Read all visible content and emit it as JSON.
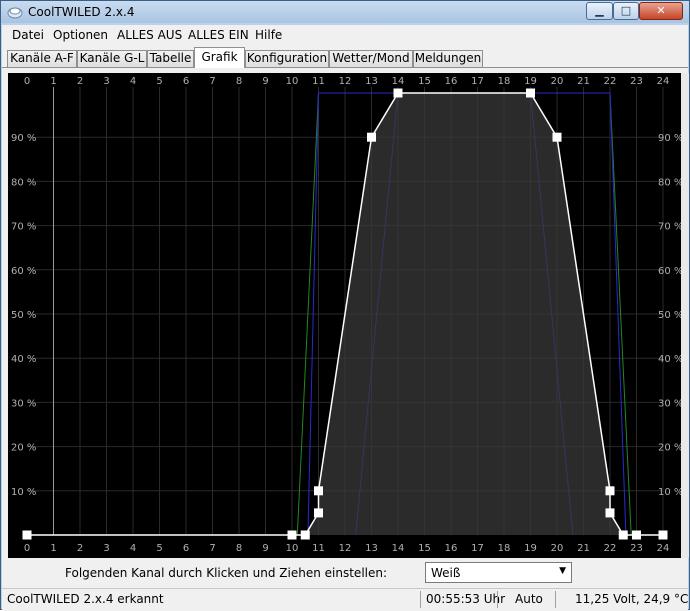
{
  "window": {
    "title": "CoolTWILED 2.x.4"
  },
  "menu": [
    "Datei",
    "Optionen",
    "ALLES AUS",
    "ALLES EIN",
    "Hilfe"
  ],
  "tabs": [
    {
      "label": "Kanäle A-F",
      "active": false
    },
    {
      "label": "Kanäle G-L",
      "active": false
    },
    {
      "label": "Tabelle",
      "active": false
    },
    {
      "label": "Grafik",
      "active": true
    },
    {
      "label": "Konfiguration",
      "active": false
    },
    {
      "label": "Wetter/Mond",
      "active": false
    },
    {
      "label": "Meldungen",
      "active": false
    }
  ],
  "chart_data": {
    "type": "line",
    "x_ticks": [
      "0",
      "1",
      "2",
      "3",
      "4",
      "5",
      "6",
      "7",
      "8",
      "9",
      "10",
      "11",
      "12",
      "13",
      "14",
      "15",
      "16",
      "17",
      "18",
      "19",
      "20",
      "21",
      "22",
      "23",
      "24"
    ],
    "y_ticks": [
      "10 %",
      "20 %",
      "30 %",
      "40 %",
      "50 %",
      "60 %",
      "70 %",
      "80 %",
      "90 %"
    ],
    "xlim": [
      0,
      24
    ],
    "ylim": [
      0,
      100
    ],
    "grid": true,
    "colors": {
      "background": "#000000",
      "grid": "#2a2a2a",
      "axis_text": "#b0b0b0",
      "series": "#ffffff",
      "fill": "#3a3a3a",
      "green": "#1f8a1f",
      "blue": "#2a2ad0"
    },
    "series": [
      {
        "points": [
          {
            "x": 0,
            "y": 0
          },
          {
            "x": 10,
            "y": 0
          },
          {
            "x": 10.5,
            "y": 0
          },
          {
            "x": 11,
            "y": 5
          },
          {
            "x": 11,
            "y": 10
          },
          {
            "x": 13,
            "y": 90
          },
          {
            "x": 14,
            "y": 100
          },
          {
            "x": 19,
            "y": 100
          },
          {
            "x": 20,
            "y": 90
          },
          {
            "x": 22,
            "y": 10
          },
          {
            "x": 22,
            "y": 5
          },
          {
            "x": 22.5,
            "y": 0
          },
          {
            "x": 23,
            "y": 0
          },
          {
            "x": 24,
            "y": 0
          }
        ]
      }
    ],
    "other_channels": [
      {
        "color": "green",
        "points": [
          {
            "x": 10.2,
            "y": 0
          },
          {
            "x": 11,
            "y": 100
          },
          {
            "x": 22,
            "y": 100
          },
          {
            "x": 22.8,
            "y": 0
          }
        ]
      },
      {
        "color": "blue",
        "points": [
          {
            "x": 10.6,
            "y": 0
          },
          {
            "x": 11,
            "y": 100
          },
          {
            "x": 22,
            "y": 100
          },
          {
            "x": 22.6,
            "y": 0
          }
        ]
      },
      {
        "color": "blue",
        "points": [
          {
            "x": 12.4,
            "y": 0
          },
          {
            "x": 14,
            "y": 100
          },
          {
            "x": 19,
            "y": 100
          },
          {
            "x": 20.6,
            "y": 0
          }
        ]
      }
    ],
    "cursor_x": 1
  },
  "instruction": "Folgenden Kanal durch Klicken und Ziehen einstellen:",
  "channel_select": {
    "value": "Weiß"
  },
  "status": {
    "device": "CoolTWILED 2.x.4 erkannt",
    "time": "00:55:53 Uhr",
    "mode": "Auto",
    "measure": "11,25 Volt, 24,9 °C"
  }
}
